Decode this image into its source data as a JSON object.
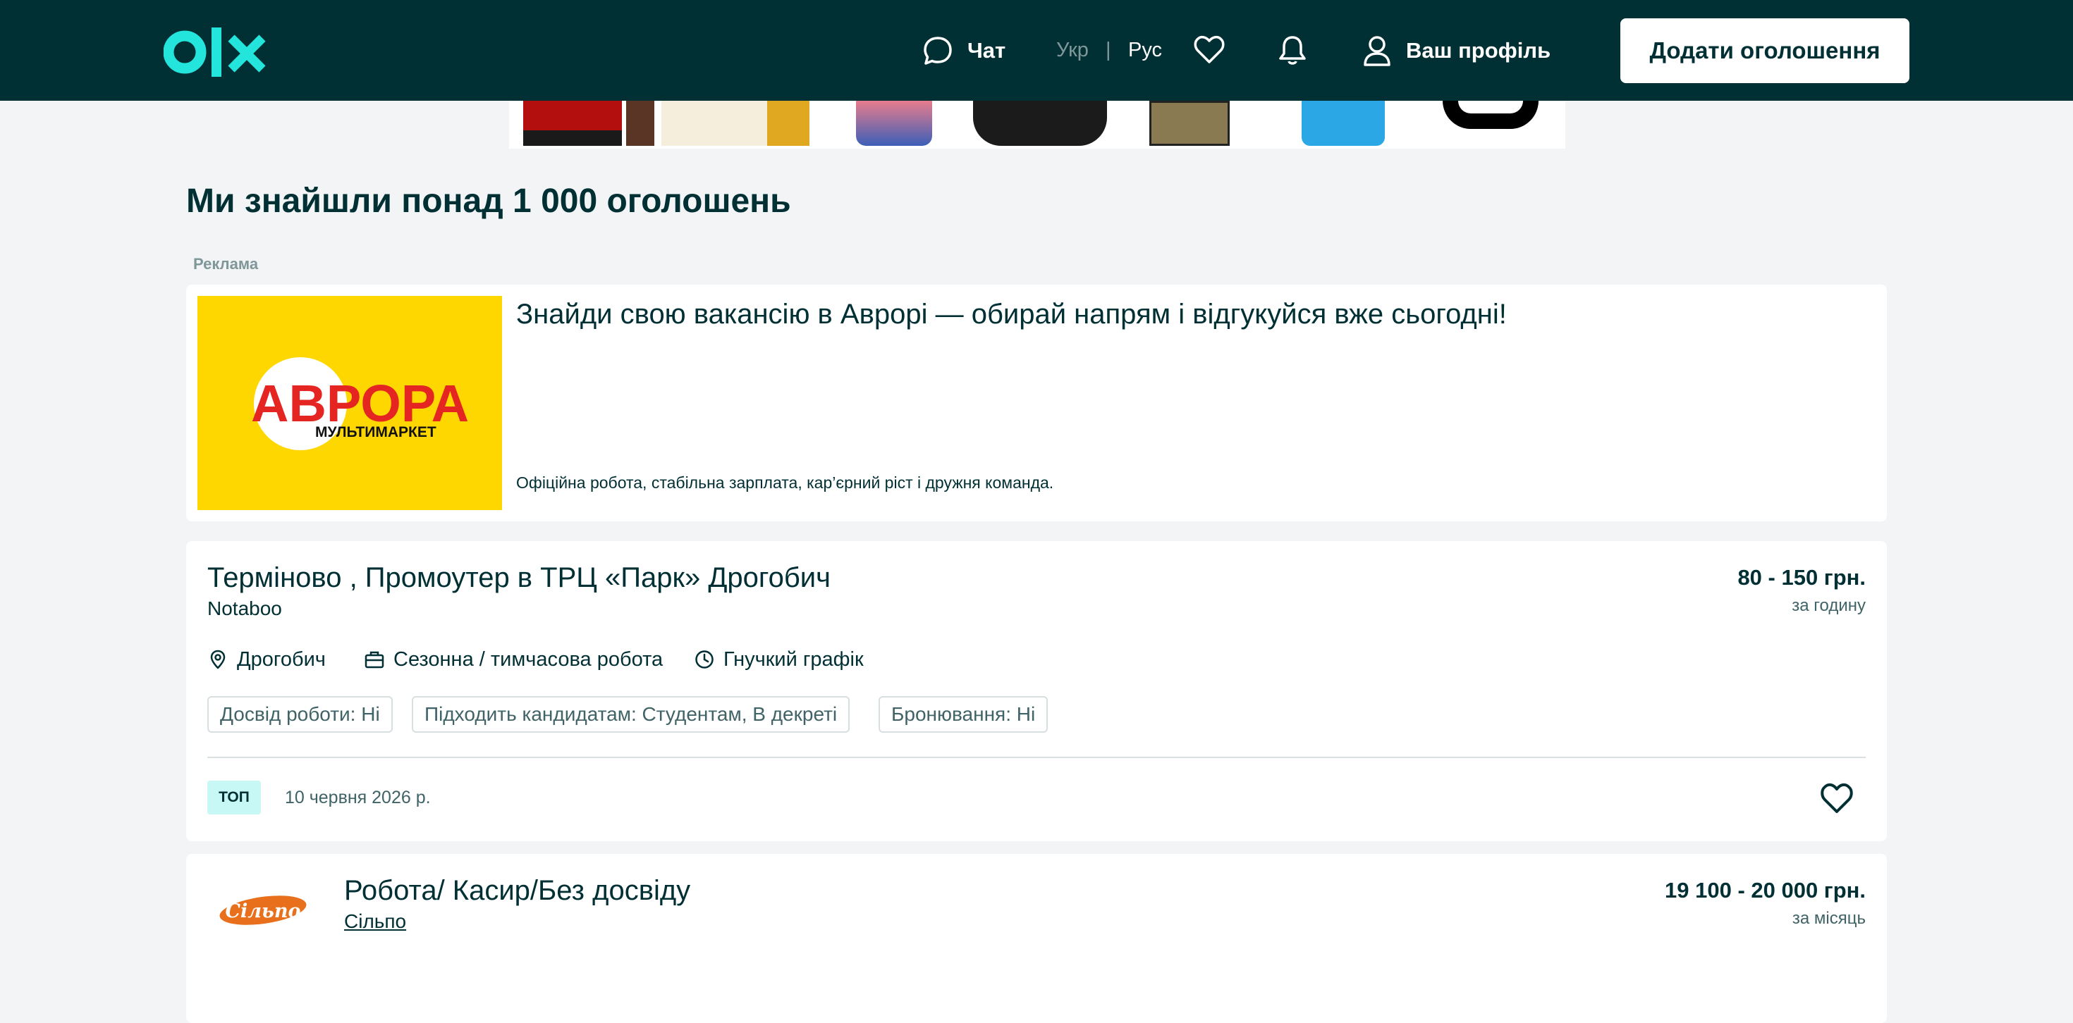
{
  "header": {
    "chat_label": "Чат",
    "lang_ukr": "Укр",
    "lang_separator": "|",
    "lang_rus": "Рус",
    "profile_label": "Ваш профіль",
    "add_button_label": "Додати оголошення"
  },
  "results_title": "Ми знайшли понад 1 000 оголошень",
  "ad_label": "Реклама",
  "promo": {
    "title": "Знайди свою вакансію в Аврорі — обирай напрям і відгукуйся вже сьогодні!",
    "text": "Офіційна робота, стабільна зарплата, кар’єрний ріст і дружня команда.",
    "logo_brand": "АВРОРА",
    "logo_sub": "МУЛЬТИМАРКЕТ"
  },
  "listings": [
    {
      "title": "Терміново , Промоутер в ТРЦ «Парк» Дрогобич",
      "employer": "Notaboo",
      "price": "80 - 150 грн.",
      "period": "за годину",
      "location": "Дрогобич",
      "job_type": "Сезонна / тимчасова робота",
      "schedule": "Гнучкий графік",
      "tags": [
        "Досвід роботи: Ні",
        "Підходить кандидатам: Студентам, В декреті",
        "Бронювання: Ні"
      ],
      "badge": "ТОП",
      "date": "10 червня 2026 р."
    },
    {
      "title": "Робота/ Касир/Без досвіду",
      "employer": "Сільпо",
      "price": "19 100 - 20 000 грн.",
      "period": "за місяць",
      "logo_text": "Сільпо"
    }
  ],
  "colors": {
    "header_bg": "#002f34",
    "accent": "#23e5db",
    "page_bg": "#f2f4f5",
    "promo_yellow": "#ffd700",
    "silpo_orange": "#e8701c"
  }
}
